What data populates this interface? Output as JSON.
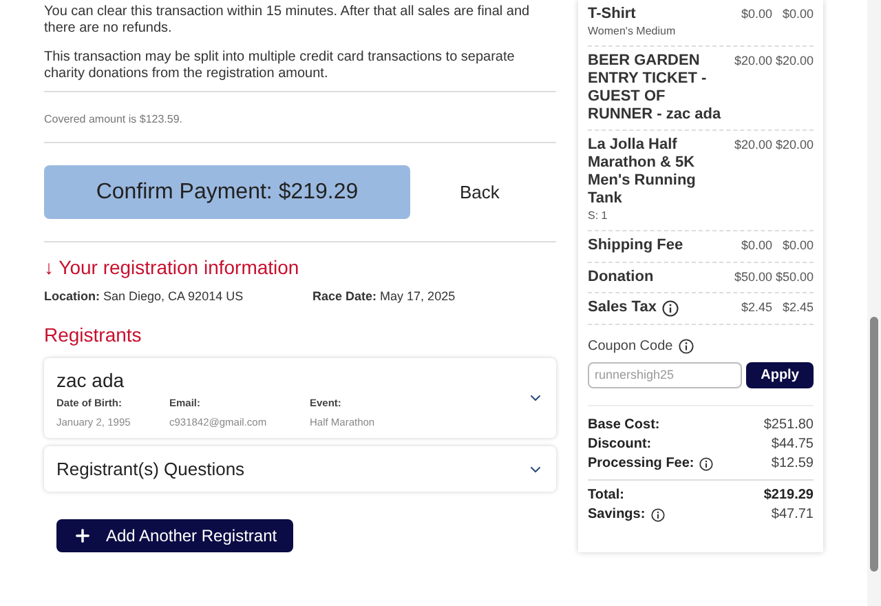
{
  "notices": [
    "You can clear this transaction within 15 minutes. After that all sales are final and there are no refunds.",
    "This transaction may be split into multiple credit card transactions to separate charity donations from the registration amount."
  ],
  "covered_note": "Covered amount is $123.59.",
  "confirm_button": "Confirm Payment: $219.29",
  "back_link": "Back",
  "registration": {
    "heading": "↓ Your registration information",
    "location_label": "Location:",
    "location": "San Diego, CA 92014 US",
    "date_label": "Race Date:",
    "date": "May 17, 2025"
  },
  "registrants_heading": "Registrants",
  "registrants": [
    {
      "name": "zac ada",
      "expanded": false,
      "fields": [
        {
          "label": "Date of Birth:",
          "value": "January 2, 1995"
        },
        {
          "label": "Email:",
          "value": "c931842@gmail.com"
        },
        {
          "label": "Event:",
          "value": "Half Marathon"
        }
      ]
    }
  ],
  "questions": {
    "title": "Registrant(s) Questions",
    "expanded": false
  },
  "add_button": "Add Another Registrant",
  "cart_items": [
    {
      "name": "T-Shirt",
      "detail": "Women's Medium",
      "price": "$0.00",
      "total": "$0.00",
      "info": false
    },
    {
      "name": "BEER GARDEN ENTRY TICKET - GUEST OF RUNNER - zac ada",
      "price": "$20.00",
      "total": "$20.00",
      "info": false
    },
    {
      "name": "La Jolla Half Marathon & 5K Men's Running Tank",
      "detail": "S: 1",
      "price": "$20.00",
      "total": "$20.00",
      "info": false
    },
    {
      "name": "Shipping Fee",
      "price": "$0.00",
      "total": "$0.00",
      "info": false
    },
    {
      "name": "Donation",
      "price": "$50.00",
      "total": "$50.00",
      "info": false
    },
    {
      "name": "Sales Tax",
      "price": "$2.45",
      "total": "$2.45",
      "info": true
    }
  ],
  "coupon": {
    "label": "Coupon Code",
    "placeholder": "runnershigh25",
    "button": "Apply"
  },
  "summary": [
    {
      "label": "Base Cost:",
      "value": "$251.80",
      "info": false,
      "total": false
    },
    {
      "label": "Discount:",
      "value": "$44.75",
      "info": false,
      "total": false
    },
    {
      "label": "Processing Fee:",
      "value": "$12.59",
      "info": true,
      "total": false
    }
  ],
  "totals": [
    {
      "label": "Total:",
      "value": "$219.29",
      "info": false,
      "total": true
    },
    {
      "label": "Savings:",
      "value": "$47.71",
      "info": true,
      "total": false
    }
  ]
}
